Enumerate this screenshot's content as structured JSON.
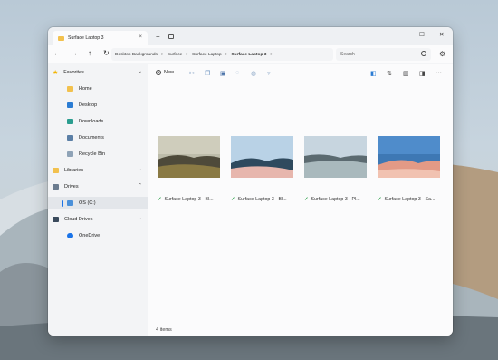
{
  "window": {
    "tab_title": "Surface Laptop 3",
    "tab_close": "×",
    "new_tab": "+",
    "minimize": "—",
    "maximize": "☐",
    "close": "✕"
  },
  "nav": {
    "back": "←",
    "forward": "→",
    "up": "↑",
    "refresh": "↻",
    "breadcrumb": [
      "Desktop Backgrounds",
      "Surface",
      "Surface Laptop",
      "Surface Laptop 3"
    ],
    "breadcrumb_separator": ">",
    "search_placeholder": "Search",
    "settings_icon": "gear-icon"
  },
  "sidebar": {
    "favorites": {
      "label": "Favorites",
      "expand": "⌄"
    },
    "favorites_items": [
      {
        "label": "Home",
        "icon": "home-icon"
      },
      {
        "label": "Desktop",
        "icon": "desktop-icon"
      },
      {
        "label": "Downloads",
        "icon": "downloads-icon"
      },
      {
        "label": "Documents",
        "icon": "documents-icon"
      },
      {
        "label": "Recycle Bin",
        "icon": "recycle-bin-icon"
      }
    ],
    "libraries": {
      "label": "Libraries",
      "expand": "⌄"
    },
    "drives": {
      "label": "Drives",
      "expand": "⌃"
    },
    "drive_items": [
      {
        "label": "OS (C:)",
        "icon": "drive-icon"
      }
    ],
    "cloud": {
      "label": "Cloud Drives",
      "expand": "⌄"
    },
    "cloud_items": [
      {
        "label": "OneDrive",
        "icon": "onedrive-icon"
      }
    ]
  },
  "toolbar": {
    "new_label": "New",
    "new_icon": "+",
    "more": "···"
  },
  "files": [
    {
      "name": "Surface Laptop 3 - Bl...",
      "check": "✓"
    },
    {
      "name": "Surface Laptop 3 - Bl...",
      "check": "✓"
    },
    {
      "name": "Surface Laptop 3 - Pl...",
      "check": "✓"
    },
    {
      "name": "Surface Laptop 3 - Sa...",
      "check": "✓"
    }
  ],
  "status": {
    "items": "4 items"
  },
  "colors": {
    "accent": "#1a73e8",
    "check": "#1f9b3d",
    "folder": "#f2c14e"
  }
}
